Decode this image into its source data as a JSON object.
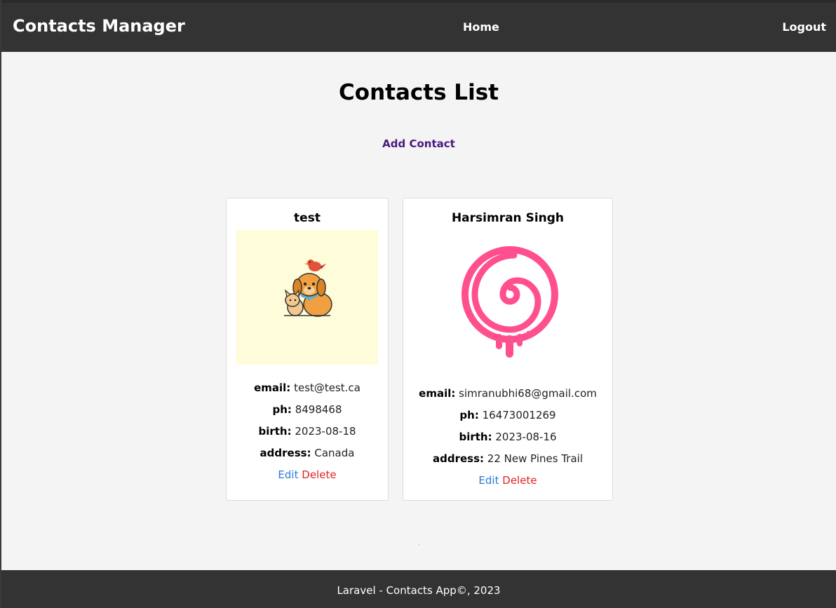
{
  "navbar": {
    "brand": "Contacts Manager",
    "home_label": "Home",
    "logout_label": "Logout"
  },
  "main": {
    "title": "Contacts List",
    "add_contact_label": "Add Contact"
  },
  "labels": {
    "email": "email:",
    "phone": "ph:",
    "birth": "birth:",
    "address": "address:",
    "edit": "Edit",
    "delete": "Delete"
  },
  "contacts": [
    {
      "name": "test",
      "avatar": "dog-cat-bird-illustration",
      "email": "test@test.ca",
      "phone": "8498468",
      "birth": "2023-08-18",
      "address": "Canada"
    },
    {
      "name": "Harsimran Singh",
      "avatar": "pink-dripping-spiral",
      "email": "simranubhi68@gmail.com",
      "phone": "16473001269",
      "birth": "2023-08-16",
      "address": "22 New Pines Trail"
    }
  ],
  "colors": {
    "navbar_bg": "#333333",
    "page_bg": "#f4f4f4",
    "add_link": "#4a1a7e",
    "edit_link": "#2a7bd4",
    "delete_link": "#e02424",
    "avatar_1_bg": "#fffcd9",
    "spiral_pink": "#ff4f8f"
  },
  "footer": {
    "text": "Laravel - Contacts App©, 2023"
  }
}
